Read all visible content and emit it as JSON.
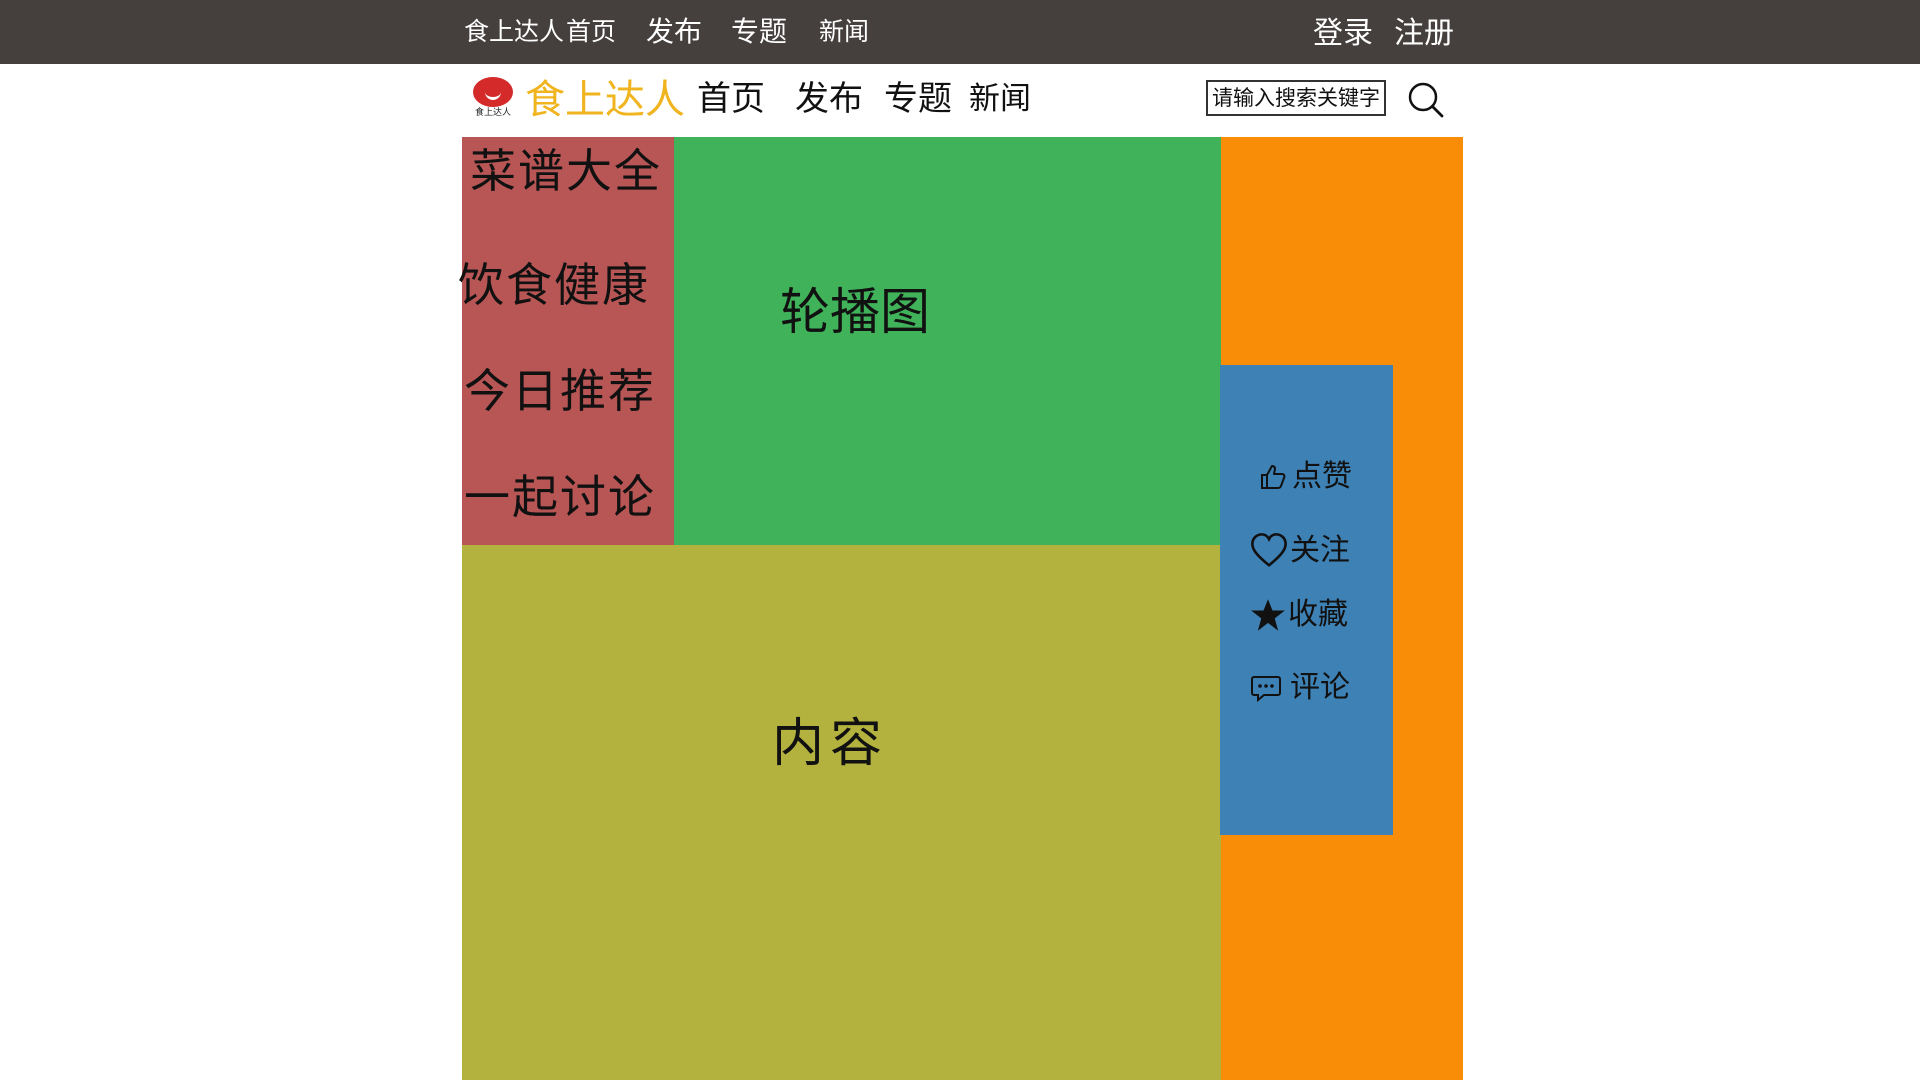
{
  "topbar": {
    "brand": "食上达人",
    "nav": [
      "首页",
      "发布",
      "专题",
      "新闻"
    ],
    "login": "登录",
    "register": "注册"
  },
  "navbar": {
    "logo_caption": "食上达人",
    "brand": "食上达人",
    "nav": [
      "首页",
      "发布",
      "专题",
      "新闻"
    ],
    "search_placeholder": "请输入搜索关键字"
  },
  "sidebar": {
    "items": [
      "菜谱大全",
      "饮食健康",
      "今日推荐",
      "一起讨论"
    ]
  },
  "carousel": {
    "label": "轮播图"
  },
  "content": {
    "label": "内容"
  },
  "actions": {
    "items": [
      {
        "icon": "thumbs-up-icon",
        "label": "点赞"
      },
      {
        "icon": "heart-icon",
        "label": "关注"
      },
      {
        "icon": "star-icon",
        "label": "收藏"
      },
      {
        "icon": "comment-icon",
        "label": "评论"
      }
    ]
  },
  "colors": {
    "topbar": "#453f3e",
    "brand": "#f0b41e",
    "sidebar": "#b85555",
    "carousel": "#40b35a",
    "content": "#b3b23f",
    "side_panel": "#f98d07",
    "actions_panel": "#3e81b4"
  }
}
